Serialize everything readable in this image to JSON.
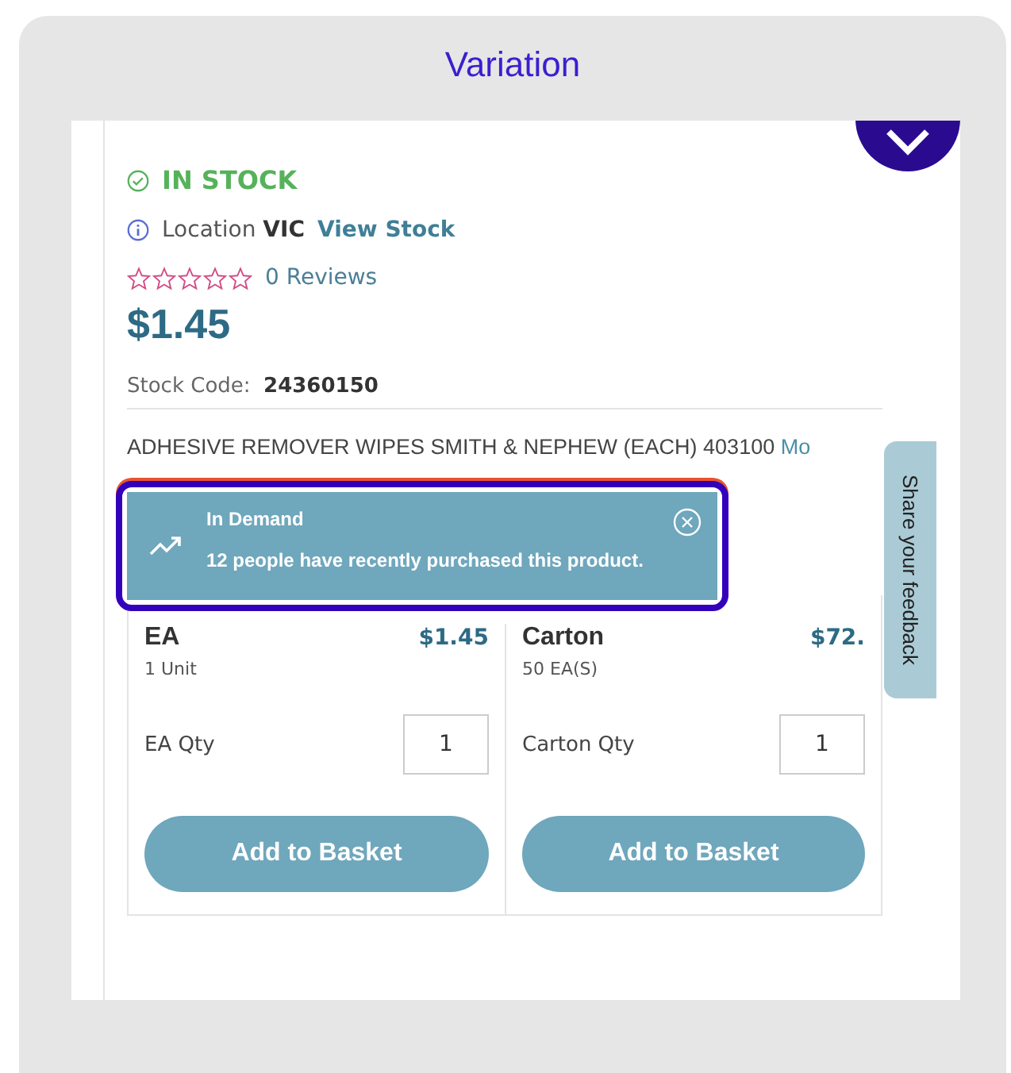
{
  "card_title": "Variation",
  "stock_status": "IN STOCK",
  "location": {
    "label": "Location",
    "value": "VIC",
    "link": "View Stock"
  },
  "rating": {
    "stars": 0,
    "reviews": "0 Reviews"
  },
  "price": "$1.45",
  "stock_code": {
    "label": "Stock Code:",
    "value": "24360150"
  },
  "description": {
    "text": "ADHESIVE REMOVER WIPES SMITH & NEPHEW (EACH) 403100",
    "more_link": "Mo"
  },
  "notification": {
    "title": "In Demand",
    "message": "12 people have recently purchased this product."
  },
  "feedback_tab": "Share your feedback",
  "variants": [
    {
      "name": "EA",
      "price": "$1.45",
      "pack": "1 Unit",
      "qty_label": "EA Qty",
      "qty": "1",
      "button": "Add to Basket"
    },
    {
      "name": "Carton",
      "price": "$72.",
      "pack": "50 EA(S)",
      "qty_label": "Carton Qty",
      "qty": "1",
      "button": "Add to Basket"
    }
  ]
}
